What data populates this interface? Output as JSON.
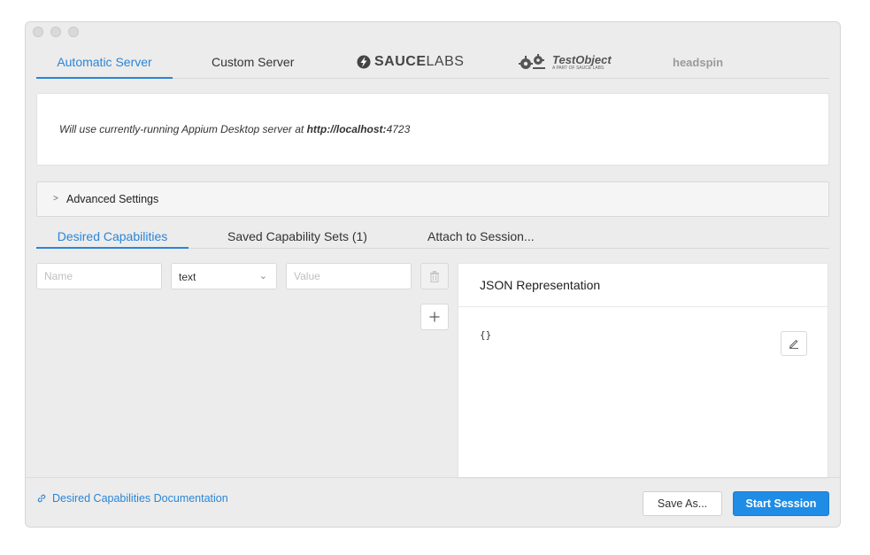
{
  "server_tabs": {
    "automatic": "Automatic Server",
    "custom": "Custom Server",
    "sauce_bold": "SAUCE",
    "sauce_light": "LABS",
    "testobject_title": "TestObject",
    "testobject_sub": "A PART OF SAUCE LABS",
    "headspin": "headspin"
  },
  "info": {
    "prefix": "Will use currently-running Appium Desktop server at ",
    "url_bold": "http://localhost:",
    "port": "4723"
  },
  "advanced": {
    "chevron": ">",
    "label": "Advanced Settings"
  },
  "cap_tabs": {
    "desired": "Desired Capabilities",
    "saved": "Saved Capability Sets (1)",
    "attach": "Attach to Session..."
  },
  "capability_row": {
    "name_placeholder": "Name",
    "type_value": "text",
    "value_placeholder": "Value"
  },
  "json_panel": {
    "title": "JSON Representation",
    "content": "{}"
  },
  "footer": {
    "doc_link": "Desired Capabilities Documentation",
    "save_as": "Save As...",
    "start_session": "Start Session"
  },
  "colors": {
    "accent": "#2a85d8",
    "primary_button": "#1f8ce6"
  }
}
